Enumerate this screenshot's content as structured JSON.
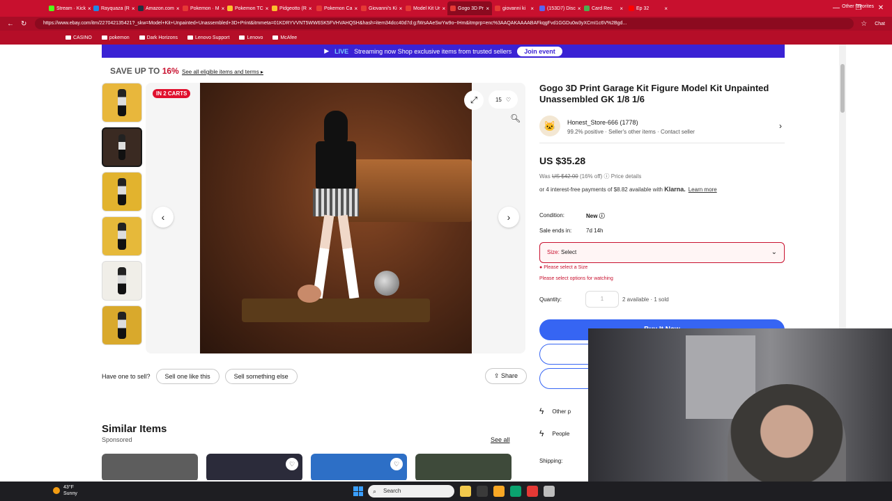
{
  "browser": {
    "tabs": [
      {
        "label": "Stream · Kick",
        "color": "#53fc18"
      },
      {
        "label": "Rayquaza (R",
        "color": "#1e88e5"
      },
      {
        "label": "Amazon.com",
        "color": "#232f3e"
      },
      {
        "label": "Pokemon · M",
        "color": "#e53935"
      },
      {
        "label": "Pokemon TC",
        "color": "#fbc02d"
      },
      {
        "label": "Pidgeotto (R",
        "color": "#fbc02d"
      },
      {
        "label": "Pokemon Ca",
        "color": "#e53935"
      },
      {
        "label": "Giovanni's Ki",
        "color": "#e53935"
      },
      {
        "label": "Model Kit Ur",
        "color": "#e53935"
      },
      {
        "label": "Gogo 3D Pr",
        "color": "#e53935",
        "active": true
      },
      {
        "label": "giovanni ki",
        "color": "#e53935"
      },
      {
        "label": "(153D7) Disc",
        "color": "#5865f2"
      },
      {
        "label": "Card Rec",
        "color": "#4caf50"
      },
      {
        "label": "Ep 32",
        "color": "#ff0000"
      }
    ],
    "url": "https://www.ebay.com/itm/227042135421?_skw=Model+Kit+Unpainted+Unassembled+3D+Print&itmmeta=01KDRYVVNT5WW6SK5FVHVAHQSH&hash=item34dcc40d7d:g:fWsAAeSwYw9o~IHm&itmprp=enc%3AAQAKAAAABAFkqgFvd1GGDu0w3yXCmI1c6V%2Bgd...",
    "chat_label": "Chat",
    "bookmarks": [
      "CASINO",
      "pokemon",
      "Dark Horizons",
      "Lenovo Support",
      "Lenovo",
      "McAfee"
    ],
    "other_favorites": "Other favorites"
  },
  "banner": {
    "live": "LIVE",
    "text": "Streaming now  Shop exclusive items from trusted sellers",
    "join": "Join event"
  },
  "promo": {
    "save_prefix": "SAVE UP TO ",
    "save_pct": "16%",
    "link": "See all eligible items and terms ▸"
  },
  "gallery": {
    "badge": "IN 2 CARTS",
    "watch_count": "15",
    "thumb_colors": [
      "#e8b73c",
      "#3a2a22",
      "#e2b32e",
      "#e6b93a",
      "#f0eee8",
      "#d9a92c"
    ]
  },
  "sell": {
    "question": "Have one to sell?",
    "sell_like": "Sell one like this",
    "sell_else": "Sell something else",
    "share": "Share"
  },
  "similar": {
    "title": "Similar Items",
    "sponsored": "Sponsored",
    "see_all": "See all",
    "card_colors": [
      "#5d5d5d",
      "#2b2b3a",
      "#2d6fc6",
      "#3e4a3a"
    ]
  },
  "listing": {
    "title": "Gogo 3D Print Garage Kit Figure Model Kit Unpainted Unassembled GK 1/8 1/6",
    "seller_name": "Honest_Store-666 (1778)",
    "seller_feedback": "99.2% positive · Seller's other items · Contact seller",
    "price": "US $35.28",
    "was_label": "Was ",
    "was_price": "US $42.00",
    "was_off": " (16% off)",
    "price_details": "Price details",
    "klarna_text": "or 4 interest-free payments of $8.82 available with ",
    "klarna_brand": "Klarna.",
    "learn_more": "Learn more",
    "condition_label": "Condition:",
    "condition_value": "New",
    "sale_ends_label": "Sale ends in:",
    "sale_ends_value": "7d 14h",
    "size_label": "Size:",
    "size_value": "Select",
    "error_size": "Please select a Size",
    "error_watch": "Please select options for watching",
    "quantity_label": "Quantity:",
    "quantity_value": "1",
    "quantity_avail": "2 available · 1 sold",
    "buy_now": "Buy It Now",
    "other_signal": "Other p",
    "people_signal": "People",
    "shipping_label": "Shipping:"
  },
  "taskbar": {
    "temp": "43°F",
    "weather": "Sunny",
    "search": "Search",
    "icons": [
      "#f2c94c",
      "#3a3a3a",
      "#f9a825",
      "#0aa36f",
      "#e53935",
      "#bdbdbd"
    ]
  }
}
